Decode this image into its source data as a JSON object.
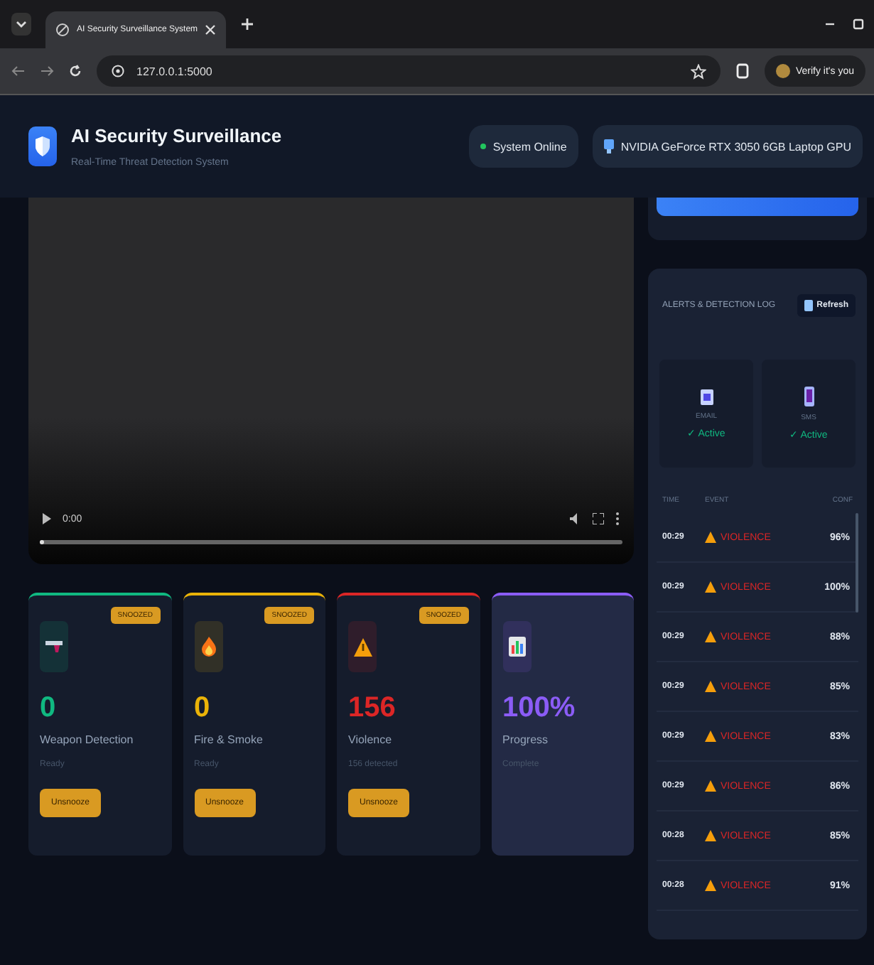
{
  "browser": {
    "tab": {
      "title": "AI Security Surveillance System"
    },
    "url": "127.0.0.1:5000",
    "profile_button": "Verify it's you"
  },
  "header": {
    "title": "AI Security Surveillance",
    "subtitle": "Real-Time Threat Detection System",
    "status": "System Online",
    "gpu": "NVIDIA GeForce RTX 3050 6GB Laptop GPU"
  },
  "video": {
    "time": "0:00",
    "level": 0
  },
  "cards": [
    {
      "kind": "weapon",
      "value": "0",
      "label": "Weapon Detection",
      "status": "Ready",
      "color": "#10b981",
      "snoozed": true,
      "badge": "SNOOZED",
      "button": "Unsnooze"
    },
    {
      "kind": "fire",
      "value": "0",
      "label": "Fire & Smoke",
      "status": "Ready",
      "color": "#eab308",
      "snoozed": true,
      "badge": "SNOOZED",
      "button": "Unsnooze"
    },
    {
      "kind": "violence",
      "value": "156",
      "label": "Violence",
      "status": "156 detected",
      "color": "#dc2626",
      "snoozed": true,
      "badge": "SNOOZED",
      "button": "Unsnooze"
    },
    {
      "kind": "progress",
      "value": "100%",
      "label": "Progress",
      "status": "Complete",
      "color": "#8b5cf6",
      "snoozed": false
    }
  ],
  "alerts": {
    "title": "ALERTS & DETECTION LOG",
    "refresh": "Refresh",
    "channels": [
      {
        "kind": "email",
        "name": "EMAIL",
        "status": "✓ Active"
      },
      {
        "kind": "sms",
        "name": "SMS",
        "status": "✓ Active"
      }
    ],
    "columns": [
      "TIME",
      "EVENT",
      "CONF"
    ],
    "rows": [
      {
        "time": "00:29",
        "event": "VIOLENCE",
        "conf": "96%"
      },
      {
        "time": "00:29",
        "event": "VIOLENCE",
        "conf": "100%"
      },
      {
        "time": "00:29",
        "event": "VIOLENCE",
        "conf": "88%"
      },
      {
        "time": "00:29",
        "event": "VIOLENCE",
        "conf": "85%"
      },
      {
        "time": "00:29",
        "event": "VIOLENCE",
        "conf": "83%"
      },
      {
        "time": "00:29",
        "event": "VIOLENCE",
        "conf": "86%"
      },
      {
        "time": "00:28",
        "event": "VIOLENCE",
        "conf": "85%"
      },
      {
        "time": "00:28",
        "event": "VIOLENCE",
        "conf": "91%"
      }
    ]
  }
}
